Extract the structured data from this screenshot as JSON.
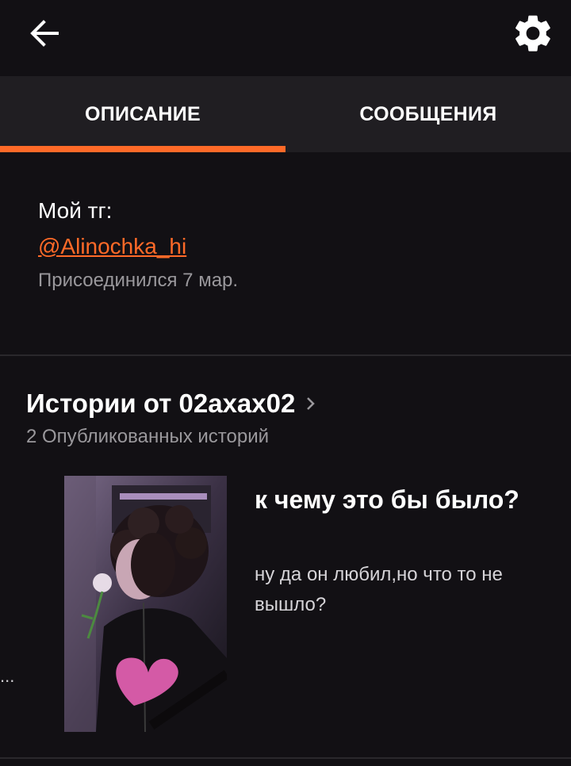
{
  "header": {
    "back_icon": "arrow-left-icon",
    "settings_icon": "gear-icon"
  },
  "tabs": [
    {
      "label": "ОПИСАНИЕ",
      "active": true
    },
    {
      "label": "СООБЩЕНИЯ",
      "active": false
    }
  ],
  "accent_color": "#ff6a28",
  "about": {
    "bio_line": "Мой тг:",
    "bio_link": "@Alinochka_hi",
    "joined": "Присоединился 7 мар."
  },
  "stories": {
    "title": "Истории от 02axax02",
    "count_text": "2 Опубликованных историй",
    "items": [
      {
        "title": "к чему это бы было?",
        "description": "ну да он любил,но что то не вышло?",
        "prev_ellipsis": "..."
      }
    ]
  }
}
